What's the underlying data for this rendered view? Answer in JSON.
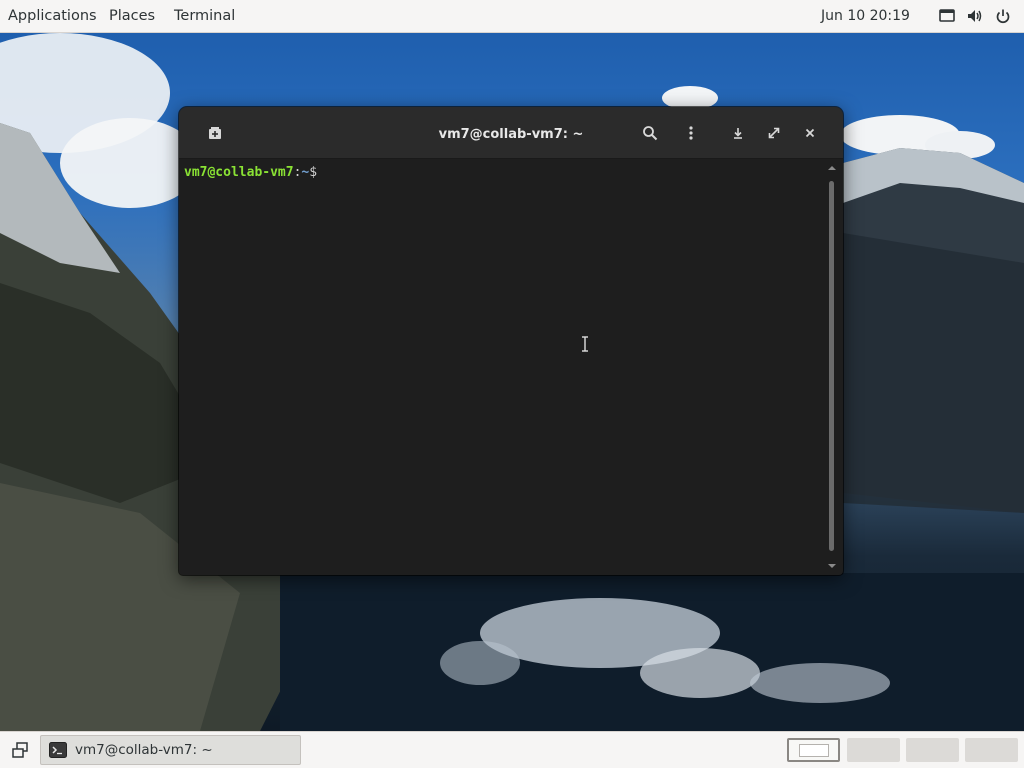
{
  "topbar": {
    "menus": [
      "Applications",
      "Places",
      "Terminal"
    ],
    "clock": "Jun 10  20:19",
    "tray_icons": [
      "screen-icon",
      "volume-icon",
      "power-icon"
    ]
  },
  "terminal": {
    "title": "vm7@collab-vm7: ~",
    "prompt": {
      "user_host": "vm7@collab-vm7",
      "separator": ":",
      "path": "~",
      "symbol": "$"
    },
    "header_icons": [
      "new-tab-icon",
      "search-icon",
      "menu-icon",
      "minimize-icon",
      "maximize-icon",
      "close-icon"
    ]
  },
  "taskbar": {
    "window_label": "vm7@collab-vm7: ~",
    "workspaces": 4,
    "active_workspace": 1
  },
  "colors": {
    "prompt_user": "#8ae234",
    "prompt_path": "#729fcf",
    "terminal_bg": "#1e1e1e",
    "headerbar_bg": "#2b2b2b",
    "panel_bg": "#f6f5f4"
  }
}
